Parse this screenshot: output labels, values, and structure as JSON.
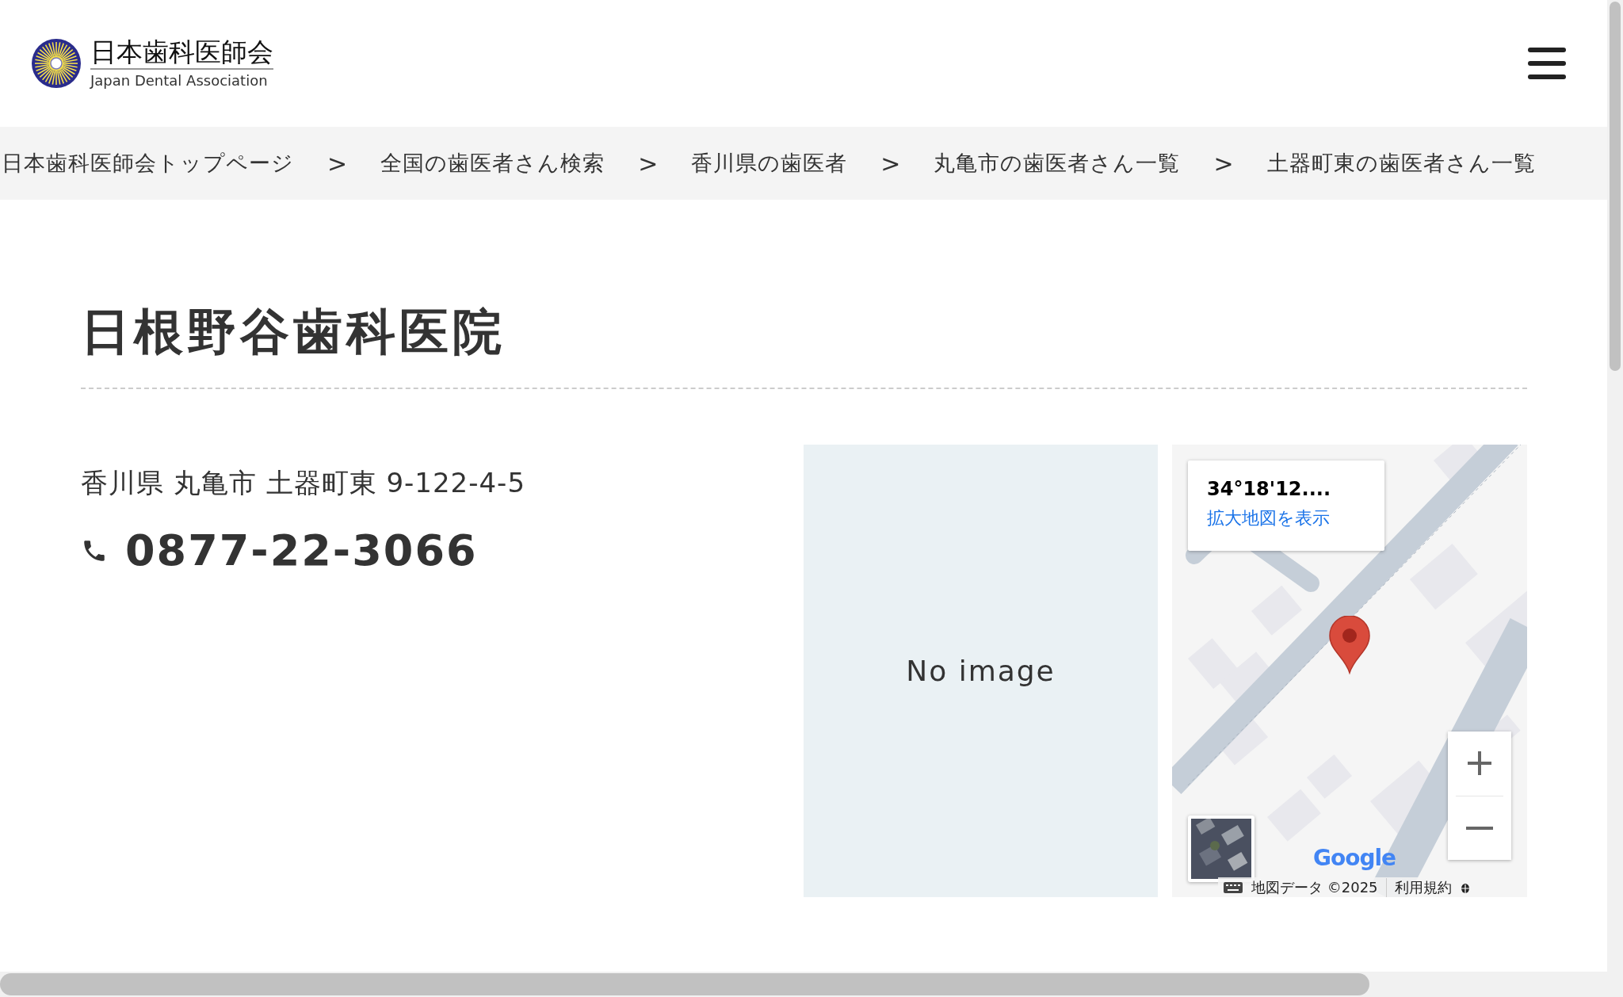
{
  "header": {
    "logo": {
      "title": "日本歯科医師会",
      "subtitle": "Japan Dental Association"
    }
  },
  "breadcrumb": [
    {
      "label": "日本歯科医師会トップページ",
      "separator": ">"
    },
    {
      "label": "全国の歯医者さん検索",
      "separator": ">"
    },
    {
      "label": "香川県の歯医者",
      "separator": ">"
    },
    {
      "label": "丸亀市の歯医者さん一覧",
      "separator": ">"
    },
    {
      "label": "土器町東の歯医者さん一覧"
    }
  ],
  "clinic": {
    "name": "日根野谷歯科医院",
    "address": "香川県 丸亀市 土器町東 9-122-4-5",
    "phone": "0877-22-3066"
  },
  "photo": {
    "placeholder": "No image"
  },
  "map": {
    "info": {
      "coordinates": "34°18'12....",
      "link": "拡大地図を表示"
    },
    "logo": "Google",
    "attribution": "地図データ ©2025",
    "terms": "利用規約"
  }
}
